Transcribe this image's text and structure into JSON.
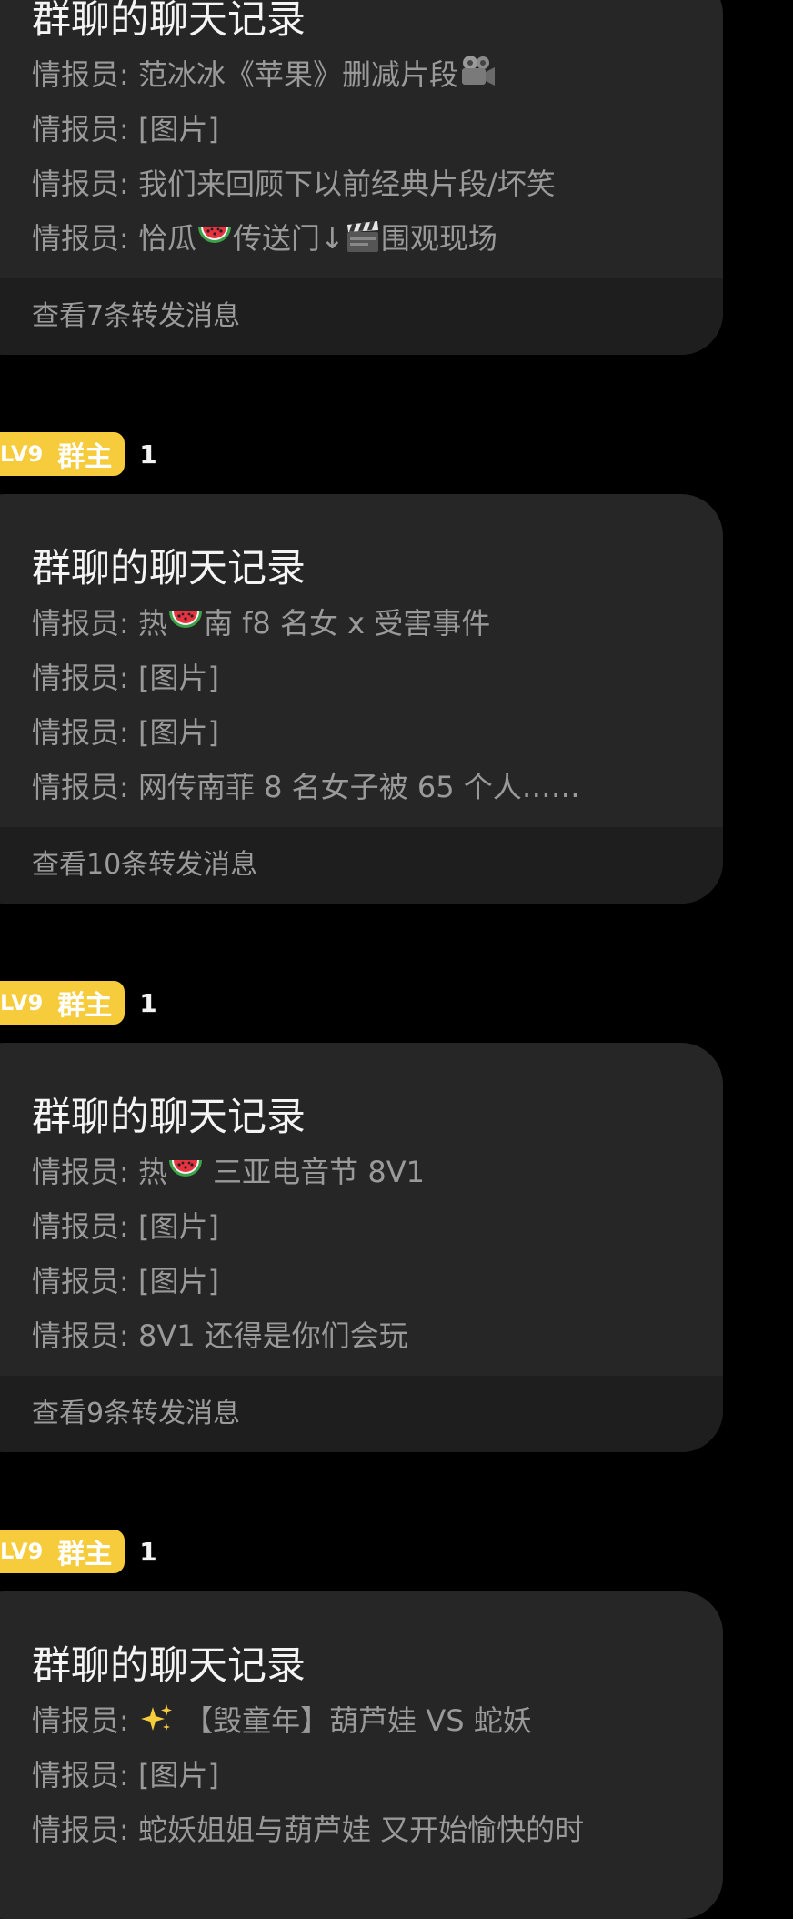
{
  "cards": [
    {
      "title": "群聊的聊天记录",
      "messages": [
        {
          "sender": "情报员",
          "text": "范冰冰《苹果》删减片段",
          "trail_icon": "movie-camera-icon"
        },
        {
          "sender": "情报员",
          "text": "[图片]"
        },
        {
          "sender": "情报员",
          "text": "我们来回顾下以前经典片段/坏笑"
        },
        {
          "sender": "情报员",
          "text_parts": [
            "恰瓜",
            "传送门↓",
            "围观现场"
          ],
          "icons": [
            "watermelon-icon",
            "clapper-board-icon"
          ]
        }
      ],
      "footer": "查看7条转发消息"
    },
    {
      "badge": {
        "level": "LV9",
        "role": "群主",
        "count": "1"
      },
      "title": "群聊的聊天记录",
      "messages": [
        {
          "sender": "情报员",
          "text_parts": [
            "热",
            "南 f8 名女 x 受害事件"
          ],
          "icons": [
            "watermelon-icon"
          ]
        },
        {
          "sender": "情报员",
          "text": "[图片]"
        },
        {
          "sender": "情报员",
          "text": "[图片]"
        },
        {
          "sender": "情报员",
          "text": "网传南菲 8 名女子被 65 个人……"
        }
      ],
      "footer": "查看10条转发消息"
    },
    {
      "badge": {
        "level": "LV9",
        "role": "群主",
        "count": "1"
      },
      "title": "群聊的聊天记录",
      "messages": [
        {
          "sender": "情报员",
          "text_parts": [
            "热",
            " 三亚电音节 8V1"
          ],
          "icons": [
            "watermelon-icon"
          ]
        },
        {
          "sender": "情报员",
          "text": "[图片]"
        },
        {
          "sender": "情报员",
          "text": "[图片]"
        },
        {
          "sender": "情报员",
          "text": "8V1 还得是你们会玩"
        }
      ],
      "footer": "查看9条转发消息"
    },
    {
      "badge": {
        "level": "LV9",
        "role": "群主",
        "count": "1"
      },
      "title": "群聊的聊天记录",
      "messages": [
        {
          "sender": "情报员",
          "text_parts": [
            "",
            " 【毁童年】葫芦娃 VS 蛇妖"
          ],
          "icons": [
            "sparkles-icon"
          ]
        },
        {
          "sender": "情报员",
          "text": "[图片]"
        },
        {
          "sender": "情报员",
          "text": "蛇妖姐姐与葫芦娃 又开始愉快的时"
        }
      ]
    }
  ],
  "separator": ": ",
  "colors": {
    "background": "#000000",
    "card": "#262626",
    "card_footer": "#1e1e1e",
    "badge": "#f6cc3c",
    "muted_text": "#9a9a9a",
    "title_text": "#f4f4f4"
  }
}
